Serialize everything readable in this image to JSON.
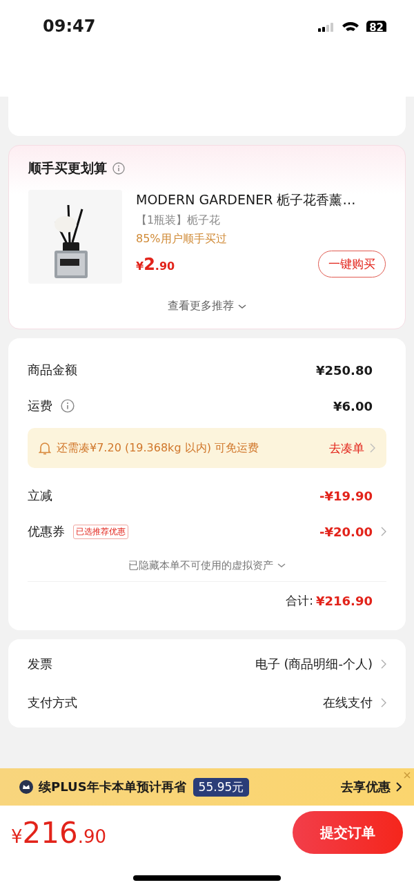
{
  "status_bar": {
    "time": "09:47",
    "battery": "82"
  },
  "recommendation": {
    "title": "顺手买更划算",
    "product": {
      "kind": "picture",
      "name": "MODERN GARDENER 栀子花香薰…",
      "spec": "【1瓶装】栀子花",
      "social_proof": "85%用户顺手买过",
      "currency": "¥",
      "price_int": "2",
      "price_dec": ".90",
      "button": "一键购买"
    },
    "more": "查看更多推荐"
  },
  "summary": {
    "rows": [
      {
        "label": "商品金额",
        "value": "¥250.80",
        "info": false,
        "highlight": false,
        "chevron": false
      },
      {
        "label": "运费",
        "value": "¥6.00",
        "info": true,
        "highlight": false,
        "chevron": false
      },
      {
        "label": "立减",
        "value": "-¥19.90",
        "info": false,
        "highlight": true,
        "chevron": false
      },
      {
        "label": "优惠券",
        "tag": "已选推荐优惠",
        "value": "-¥20.00",
        "info": false,
        "highlight": true,
        "chevron": true
      }
    ],
    "notice": {
      "text": "还需凑¥7.20 (19.368kg 以内) 可免运费",
      "action": "去凑单"
    },
    "hidden_assets": "已隐藏本单不可使用的虚拟资产",
    "total": {
      "label": "合计:",
      "value": "¥216.90"
    }
  },
  "settings": [
    {
      "label": "发票",
      "value": "电子 (商品明细-个人)"
    },
    {
      "label": "支付方式",
      "value": "在线支付"
    }
  ],
  "plus_banner": {
    "text": "续PLUS年卡本单预计再省",
    "badge": "55.95元",
    "action": "去享优惠"
  },
  "footer": {
    "currency": "¥",
    "price_int": "216",
    "price_dec": ".90",
    "submit": "提交订单"
  }
}
